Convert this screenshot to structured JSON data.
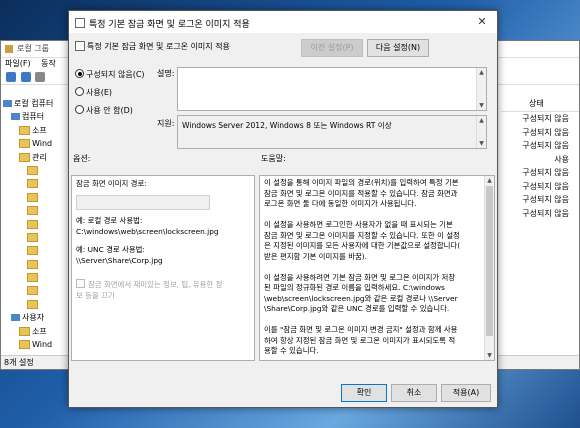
{
  "background_window": {
    "title": "로컬 그룹",
    "menu": [
      "파일(F)",
      "동작"
    ],
    "tree": [
      {
        "label": "로컬 컴퓨터",
        "kind": "pc",
        "indent": 0
      },
      {
        "label": "컴퓨터",
        "kind": "pc",
        "indent": 1
      },
      {
        "label": "소프",
        "kind": "folder",
        "indent": 2
      },
      {
        "label": "Wind",
        "kind": "folder",
        "indent": 2
      },
      {
        "label": "관리",
        "kind": "folder",
        "indent": 2
      },
      {
        "label": "",
        "kind": "folder",
        "indent": 3
      },
      {
        "label": "",
        "kind": "folder",
        "indent": 3
      },
      {
        "label": "",
        "kind": "folder",
        "indent": 3
      },
      {
        "label": "",
        "kind": "folder",
        "indent": 3
      },
      {
        "label": "",
        "kind": "folder",
        "indent": 3
      },
      {
        "label": "",
        "kind": "folder",
        "indent": 3
      },
      {
        "label": "",
        "kind": "folder",
        "indent": 3
      },
      {
        "label": "",
        "kind": "folder",
        "indent": 3
      },
      {
        "label": "",
        "kind": "folder",
        "indent": 3
      },
      {
        "label": "",
        "kind": "folder",
        "indent": 3
      },
      {
        "label": "",
        "kind": "folder",
        "indent": 3
      },
      {
        "label": "사용자",
        "kind": "pc",
        "indent": 1
      },
      {
        "label": "소프",
        "kind": "folder",
        "indent": 2
      },
      {
        "label": "Wind",
        "kind": "folder",
        "indent": 2
      },
      {
        "label": "관리",
        "kind": "folder",
        "indent": 2
      }
    ],
    "state_header": "상태",
    "state_values": [
      "구성되지 않음",
      "구성되지 않음",
      "구성되지 않음",
      "사용",
      "구성되지 않음",
      "구성되지 않음",
      "구성되지 않음",
      "구성되지 않음"
    ],
    "status": "8개 설정"
  },
  "dialog": {
    "title": "특정 기본 잠금 화면 및 로그온 이미지 적용",
    "header": "특정 기본 잠금 화면 및 로그온 이미지 적용",
    "prev_button": "이전 설정(P)",
    "next_button": "다음 설정(N)",
    "radio": [
      {
        "label": "구성되지 않음(C)",
        "checked": true
      },
      {
        "label": "사용(E)",
        "checked": false
      },
      {
        "label": "사용 안 함(D)",
        "checked": false
      }
    ],
    "comment_label": "설명:",
    "supported_label": "지원:",
    "supported_value": "Windows Server 2012, Windows 8 또는 Windows RT 이상",
    "options_label": "옵션:",
    "help_label": "도움말:",
    "options": {
      "path_label": "잠금 화면 이미지 경로:",
      "local_example_label": "예: 로컬 경로 사용법:",
      "local_example_value": "C:\\windows\\web\\screen\\lockscreen.jpg",
      "unc_example_label": "예: UNC 경로 사용법:",
      "unc_example_value": "\\\\Server\\Share\\Corp.jpg",
      "checkbox_label": "잠금 화면에서 재미있는 정보, 팁, 유용한 정보 등을 끄기"
    },
    "help_text": "이 설정을 통해 이미지 파일의 경로(위치)를 입력하여 특정 기본\n잠금 화면 및 로그온 이미지를 적용할 수 있습니다. 잠금 화면과\n로그온 화면 둘 다에 동일한 이미지가 사용됩니다.\n\n이 설정을 사용하면 로그인한 사용자가 없을 때 표시되는 기본\n잠금 화면 및 로그온 이미지를 지정할 수 있습니다. 또한 이 설정\n은 지정된 이미지를 모든 사용자에 대한 기본값으로 설정합니다(\n받은 편지함 기본 이미지를 바꿈).\n\n이 설정을 사용하려면 기본 잠금 화면 및 로그온 이미지가 저장\n된 파일의 정규화된 경로 이름을 입력하세요. C:\\windows\n\\web\\screen\\lockscreen.jpg와 같은 로컬 경로나 \\\\Server\n\\Share\\Corp.jpg와 같은 UNC 경로를 입력할 수 있습니다.\n\n이를 \"잠금 화면 및 로그온 이미지 변경 금지\" 설정과 함께 사용\n하여 항상 지정된 잠금 화면 및 로그온 이미지가 표시되도록 적\n용할 수 있습니다.\n\n참고: 이 설정은 Enterprise, Education 및 Server SKU에만 적용됩\n니다.",
    "ok_button": "확인",
    "cancel_button": "취소",
    "apply_button": "적용(A)"
  }
}
